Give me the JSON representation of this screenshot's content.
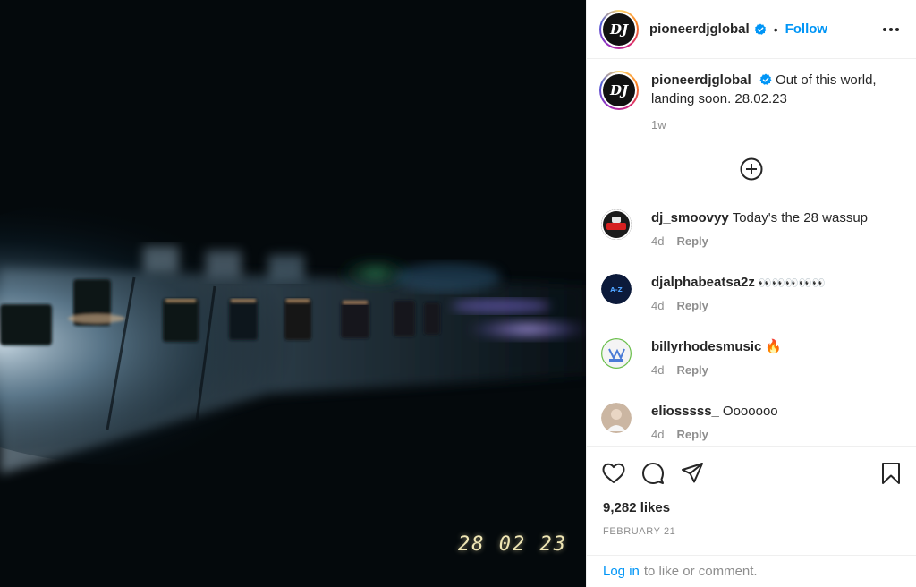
{
  "media": {
    "date_stamp": "28 02 23"
  },
  "header": {
    "avatar_text": "DJ",
    "username": "pioneerdjglobal",
    "separator": "•",
    "follow_label": "Follow",
    "more_icon": "more-horizontal-icon"
  },
  "caption": {
    "username": "pioneerdjglobal",
    "text": "Out of this world, landing soon. 28.02.23",
    "time": "1w"
  },
  "comments": [
    {
      "username": "dj_smoovyy",
      "text": "Today's the 28 wassup",
      "time": "4d",
      "reply_label": "Reply"
    },
    {
      "username": "djalphabeatsa2z",
      "text": "👀👀👀👀👀",
      "time": "4d",
      "reply_label": "Reply"
    },
    {
      "username": "billyrhodesmusic",
      "text": "🔥",
      "time": "4d",
      "reply_label": "Reply"
    },
    {
      "username": "eliosssss_",
      "text": "Ooooooo",
      "time": "4d",
      "reply_label": "Reply"
    }
  ],
  "actions": {
    "like_icon": "heart-icon",
    "comment_icon": "comment-icon",
    "share_icon": "share-icon",
    "save_icon": "bookmark-icon"
  },
  "likes": "9,282 likes",
  "post_date": "FEBRUARY 21",
  "login": {
    "link": "Log in",
    "text": "to like or comment."
  },
  "colors": {
    "accent": "#0095f6",
    "text": "#262626",
    "muted": "#8e8e8e",
    "border": "#efefef"
  }
}
